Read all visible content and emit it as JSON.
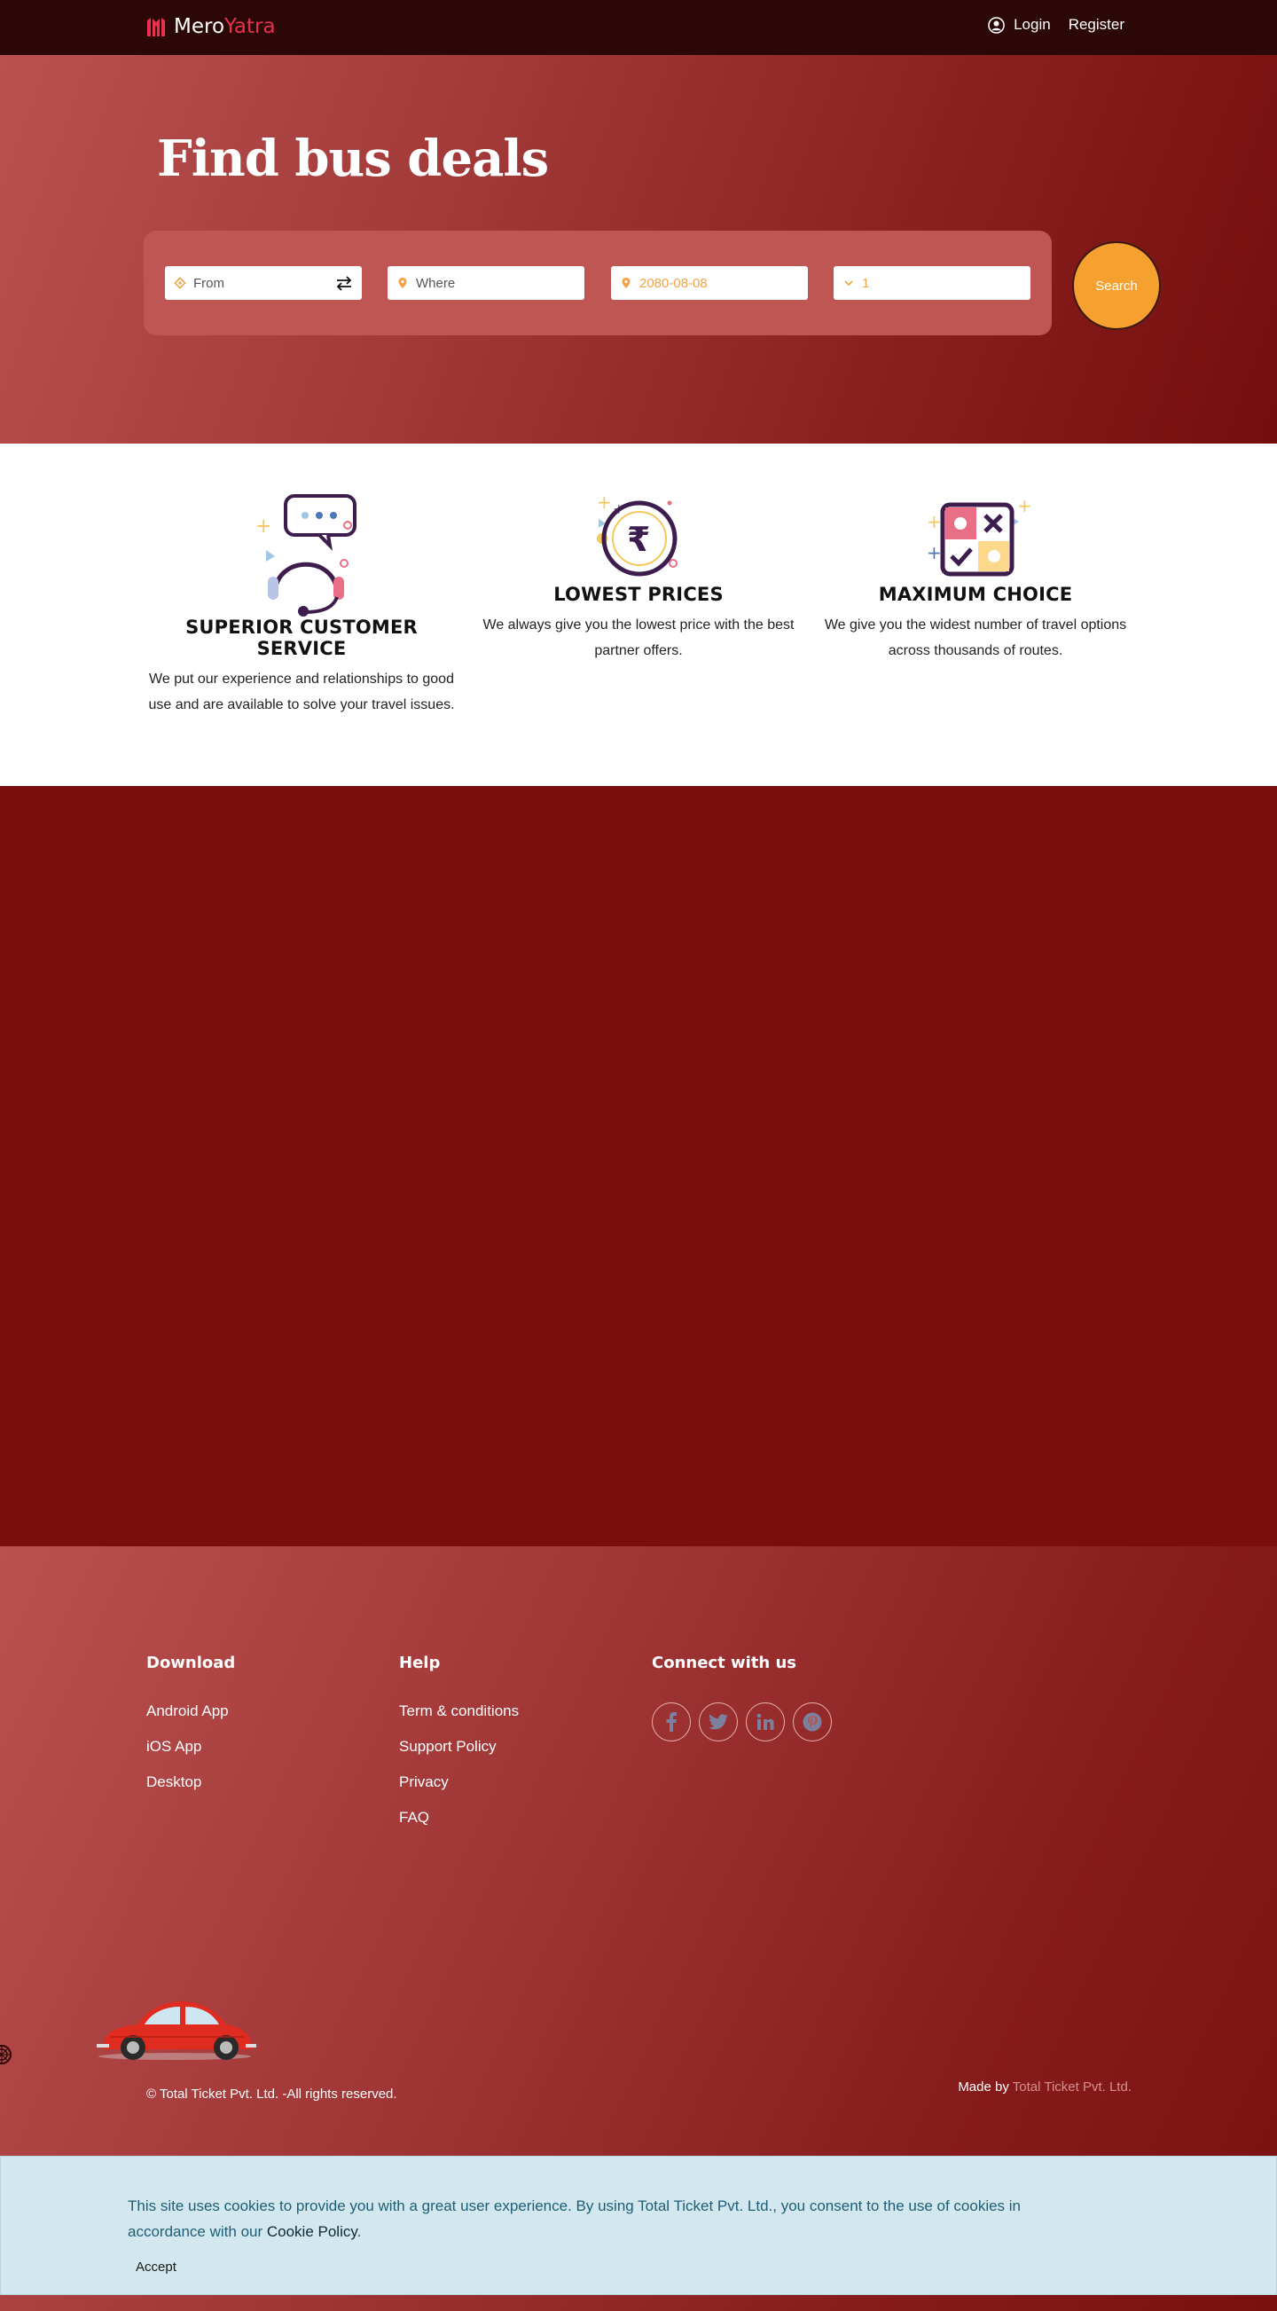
{
  "navbar": {
    "logo_left": "Mero",
    "logo_right": "Yatra",
    "login_label": "Login",
    "register_label": "Register"
  },
  "hero": {
    "title": "Find bus deals",
    "search": {
      "from_label": "From",
      "where_label": "Where",
      "date_value": "2080-08-08",
      "passengers_value": "1",
      "search_button": "Search"
    }
  },
  "features": [
    {
      "icon": "headset-chat-icon",
      "title": "SUPERIOR CUSTOMER SERVICE",
      "description": "We put our experience and relationships to good use and are available to solve your travel issues."
    },
    {
      "icon": "rupee-coin-icon",
      "title": "LOWEST PRICES",
      "description": "We always give you the lowest price with the best partner offers."
    },
    {
      "icon": "choice-grid-icon",
      "title": "MAXIMUM CHOICE",
      "description": "We give you the widest number of travel options across thousands of routes."
    }
  ],
  "footer": {
    "download": {
      "heading": "Download",
      "items": [
        "Android App",
        "iOS App",
        "Desktop"
      ]
    },
    "help": {
      "heading": "Help",
      "items": [
        "Term & conditions",
        "Support Policy",
        "Privacy",
        "FAQ"
      ]
    },
    "connect": {
      "heading": "Connect with us",
      "icons": [
        "facebook-icon",
        "twitter-icon",
        "linkedin-icon",
        "pinterest-icon"
      ]
    },
    "copyright": "© Total Ticket Pvt. Ltd. -All rights reserved.",
    "made_by_prefix": "Made by",
    "made_by_link": "Total Ticket Pvt. Ltd."
  },
  "cookie": {
    "text": "This site uses cookies to provide you with a great user experience. By using Total Ticket Pvt. Ltd., you consent to the use of cookies in accordance with our",
    "policy_link": "Cookie Policy",
    "period": ".",
    "accept_label": "Accept"
  },
  "colors": {
    "navbar_bg": "#2b0707",
    "page_bg": "#7a0e0e",
    "accent_red": "#e8314b",
    "search_button": "#f6a030",
    "cookie_bg": "#d2e8ee"
  }
}
